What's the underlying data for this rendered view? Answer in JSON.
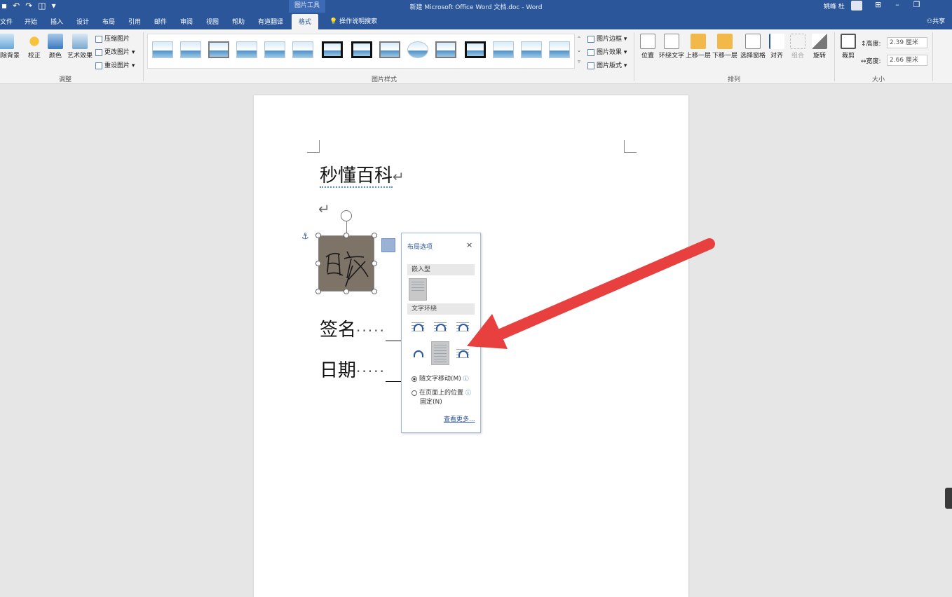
{
  "window": {
    "title": "新建 Microsoft Office Word 文档.doc  -  Word",
    "context_tab": "图片工具",
    "user": "姚峰 杜"
  },
  "tabs": [
    {
      "label": "文件"
    },
    {
      "label": "开始"
    },
    {
      "label": "插入"
    },
    {
      "label": "设计"
    },
    {
      "label": "布局"
    },
    {
      "label": "引用"
    },
    {
      "label": "邮件"
    },
    {
      "label": "审阅"
    },
    {
      "label": "视图"
    },
    {
      "label": "帮助"
    },
    {
      "label": "有道翻译"
    },
    {
      "label": "格式"
    }
  ],
  "tell_me": "操作说明搜索",
  "share": "共享",
  "ribbon": {
    "adjust": {
      "label": "调整",
      "remove_bg": "删除背景",
      "corrections": "校正",
      "color": "颜色",
      "artistic": "艺术效果",
      "compress": "压缩图片",
      "change": "更改图片",
      "reset": "重设图片"
    },
    "styles": {
      "label": "图片样式",
      "border": "图片边框",
      "effects": "图片效果",
      "layout": "图片版式"
    },
    "arrange": {
      "label": "排列",
      "position": "位置",
      "wrap": "环绕文字",
      "forward": "上移一层",
      "backward": "下移一层",
      "pane": "选择窗格",
      "align": "对齐",
      "group": "组合",
      "rotate": "旋转"
    },
    "size": {
      "label": "大小",
      "crop": "裁剪",
      "height_label": "高度:",
      "height_value": "2.39 厘米",
      "width_label": "宽度:",
      "width_value": "2.66 厘米"
    }
  },
  "document": {
    "line1": "秒懂百科",
    "para_mark": "↵",
    "sign_label": "签名",
    "date_label": "日期",
    "dots": "·····",
    "image_text": "百度"
  },
  "layout_pane": {
    "title": "布局选项",
    "close": "×",
    "inline_section": "嵌入型",
    "wrap_section": "文字环绕",
    "move_with_text": "随文字移动(M)",
    "fix_position_line1": "在页面上的位置",
    "fix_position_line2": "固定(N)",
    "see_more": "查看更多...",
    "info_icon": "ⓘ"
  },
  "icons": {
    "anchor": "⚓",
    "rotate": "⟳"
  },
  "colors": {
    "accent": "#2b579a",
    "arrow": "#e8403f"
  }
}
